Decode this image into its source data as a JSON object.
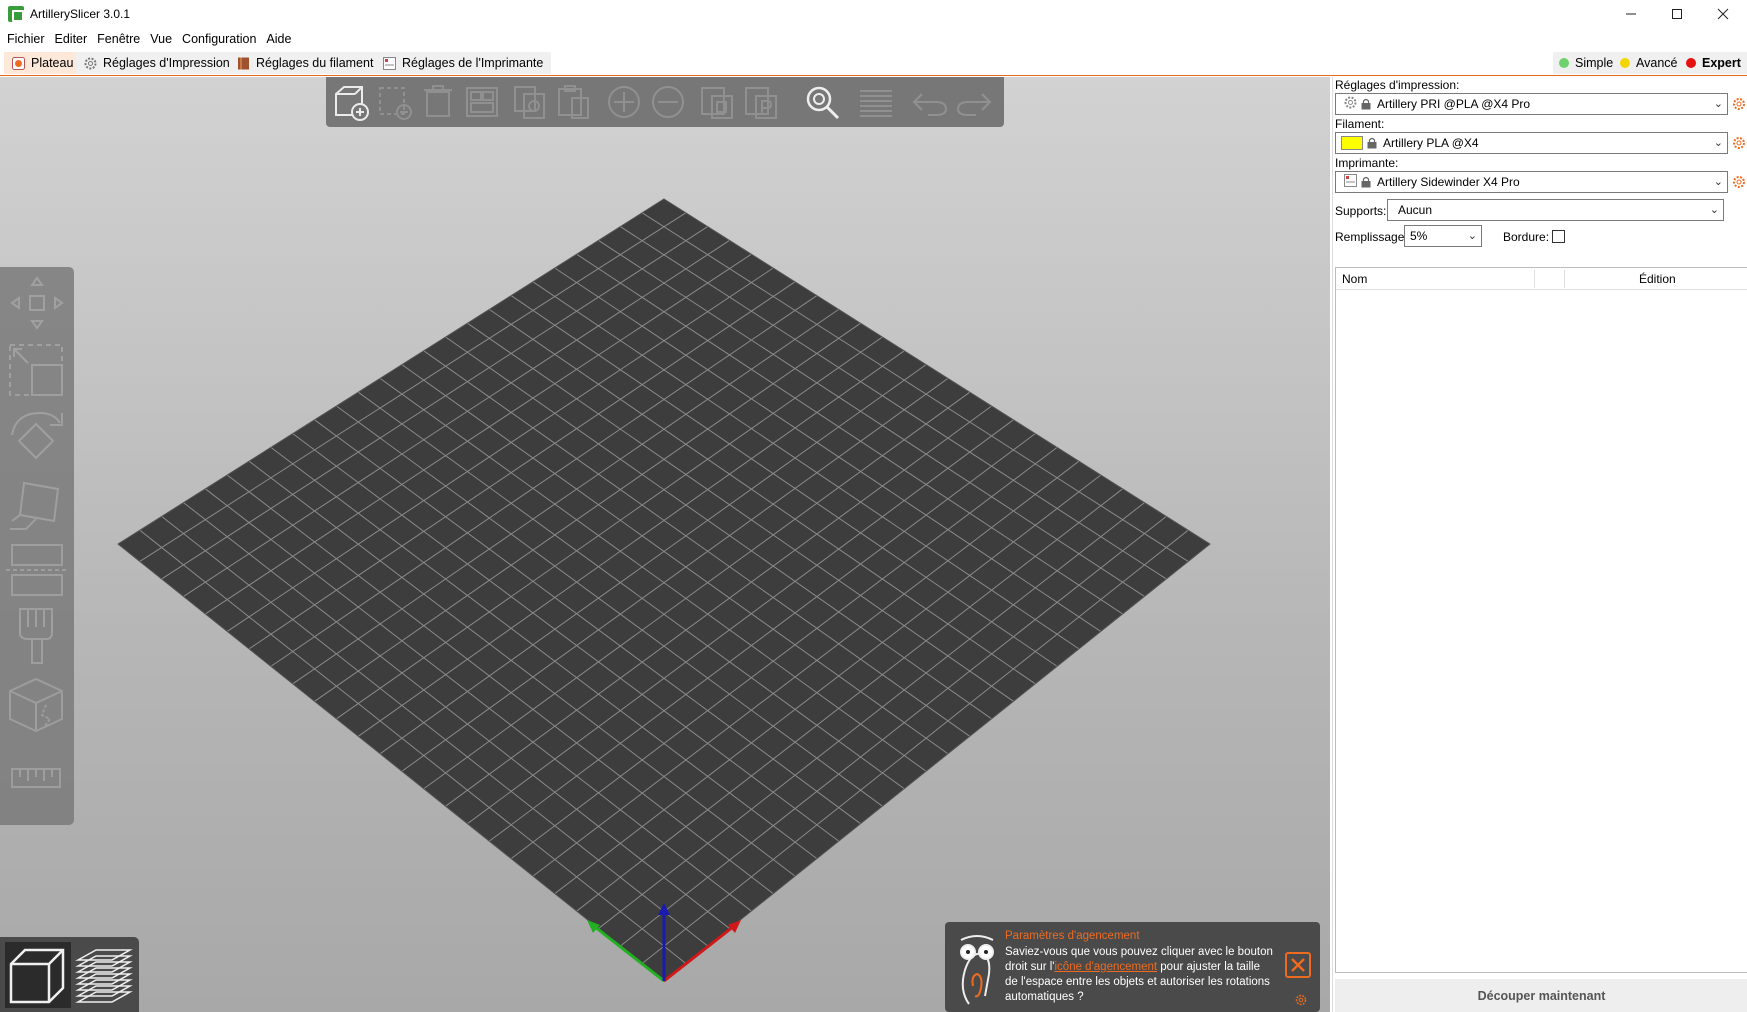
{
  "window": {
    "title": "ArtillerySlicer 3.0.1",
    "minimize_icon": "minimize-icon",
    "maximize_icon": "maximize-icon",
    "close_icon": "close-icon"
  },
  "menu": [
    "Fichier",
    "Editer",
    "Fenêtre",
    "Vue",
    "Configuration",
    "Aide"
  ],
  "tabs": [
    {
      "label": "Plateau",
      "icon": "plater-icon",
      "active": true
    },
    {
      "label": "Réglages d'Impression",
      "icon": "gear-icon",
      "active": false
    },
    {
      "label": "Réglages du filament",
      "icon": "spool-icon",
      "active": false
    },
    {
      "label": "Réglages de l'Imprimante",
      "icon": "printer-icon",
      "active": false
    }
  ],
  "modes": [
    {
      "label": "Simple",
      "color": "#6dd26d"
    },
    {
      "label": "Avancé",
      "color": "#f3d500"
    },
    {
      "label": "Expert",
      "color": "#e51010",
      "active": true
    }
  ],
  "top_toolbar": [
    "add-icon",
    "delete-icon",
    "delete-all-icon",
    "arrange-icon",
    "copy-icon",
    "paste-icon",
    "add-instance-icon",
    "remove-instance-icon",
    "split-objects-icon",
    "split-parts-icon",
    "search-icon",
    "layers-editing-icon",
    "undo-icon",
    "redo-icon"
  ],
  "left_toolbar": [
    "move-icon",
    "scale-icon",
    "rotate-icon",
    "place-on-face-icon",
    "cut-icon",
    "paint-supports-icon",
    "seam-painting-icon",
    "measure-icon"
  ],
  "view_buttons": [
    "3d-view-icon",
    "preview-layers-icon"
  ],
  "notification": {
    "title": "Paramètres d'agencement",
    "body_before": "Saviez-vous que vous pouvez cliquer avec le bouton droit sur l'",
    "link": "icône d'agencement",
    "body_after": " pour ajuster la taille de l'espace entre les objets et autoriser les rotations automatiques ?",
    "accent": "#ed6b21"
  },
  "sidebar": {
    "print_label": "Réglages d'impression:",
    "print_value": "Artillery PRI @PLA @X4 Pro",
    "filament_label": "Filament:",
    "filament_value": "Artillery PLA @X4",
    "filament_color": "#ffff00",
    "printer_label": "Imprimante:",
    "printer_value": "Artillery Sidewinder X4 Pro",
    "supports_label": "Supports:",
    "supports_value": "Aucun",
    "infill_label": "Remplissage:",
    "infill_value": "5%",
    "brim_label": "Bordure:",
    "brim_checked": false,
    "col_name": "Nom",
    "col_edit": "Édition",
    "slice_button": "Découper maintenant"
  },
  "colors": {
    "accent": "#ed6b21",
    "bed": "#3d3d3d",
    "axis_x": "#d01818",
    "axis_y": "#22b022",
    "axis_z": "#1a1ab0"
  }
}
